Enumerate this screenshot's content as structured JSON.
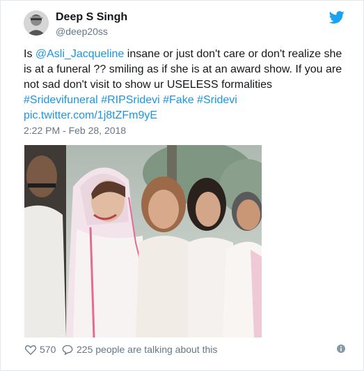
{
  "user": {
    "name": "Deep S Singh",
    "handle": "@deep20ss"
  },
  "tweet": {
    "pre_mention": "Is ",
    "mention": "@Asli_Jacqueline",
    "body": " insane or just don't care or don't realize she is at a funeral ?? smiling as if she is at an award show. If you are not sad don't visit to show ur USELESS formalities",
    "hashtags": [
      "#Sridevifuneral",
      "#RIPSridevi",
      "#Fake",
      "#Sridevi"
    ],
    "pic_link": "pic.twitter.com/1j8tZFm9yE",
    "timestamp": "2:22 PM - Feb 28, 2018"
  },
  "footer": {
    "likes": "570",
    "talking": "225 people are talking about this"
  },
  "colors": {
    "link": "#1b95e0",
    "secondary": "#657786",
    "text": "#14171a",
    "twitter_brand": "#1da1f2"
  },
  "icons": {
    "brand": "twitter-bird-icon",
    "like": "heart-icon",
    "reply": "speech-bubble-icon",
    "info": "info-icon"
  }
}
